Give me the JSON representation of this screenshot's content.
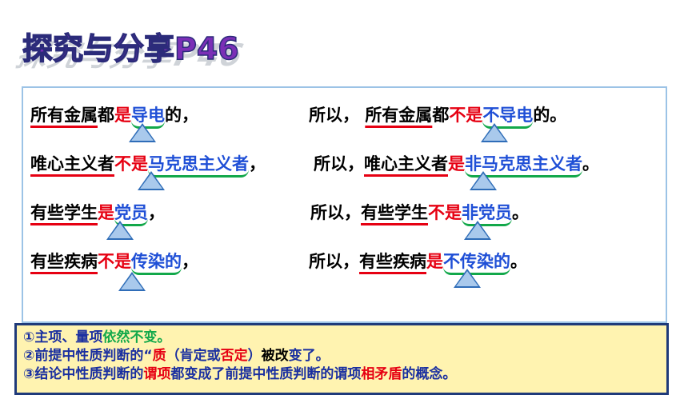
{
  "title": "探究与分享P46",
  "rows": [
    {
      "left": {
        "p1": "所有金属",
        "p2": "都",
        "p3": "是",
        "p4": "导电",
        "p5": "的，"
      },
      "right": {
        "lead": "所以，",
        "p1": "所有金属",
        "p2": "都",
        "p3": "不是",
        "p4": "不导电",
        "p5": "的。"
      }
    },
    {
      "left": {
        "p1": "唯心主义者",
        "p3": "不是",
        "p4": "马克思主义者",
        "p5": "，"
      },
      "right": {
        "lead": "所以，",
        "p1": "唯心主义者",
        "p3": "是",
        "p4": "非马克思主义者",
        "p5": "。"
      }
    },
    {
      "left": {
        "p1": "有些学生",
        "p3": "是",
        "p4": "党员",
        "p5": "，"
      },
      "right": {
        "lead": "所以，",
        "p1": "有些学生",
        "p3": "不是",
        "p4": "非党员",
        "p5": "。"
      }
    },
    {
      "left": {
        "p1": "有些疾病",
        "p3": "不是",
        "p4": "传染的",
        "p5": "，"
      },
      "right": {
        "lead": "所以，",
        "p1": "有些疾病",
        "p3": "是",
        "p4": "不传染的",
        "p5": "。"
      }
    }
  ],
  "notes": {
    "n1": {
      "a": "①主项、量项",
      "b": "依然不变。"
    },
    "n2": {
      "a": "②前提中性质判断的“",
      "b": "质",
      "c": "（肯定或",
      "d": "否定",
      "e": "）",
      "f": "被改",
      "g": "变了。"
    },
    "n3": {
      "a": "③结论中性质判断的",
      "b": "谓项",
      "c": "都变成了前提中性质判断的谓项",
      "d": "相矛盾",
      "e": "的概念。"
    }
  },
  "colors": {
    "red": "#e60012",
    "blue": "#1f4fd6",
    "green": "#12a84a",
    "triangle": "#2f6db8",
    "note_bg": "#fff3b0"
  }
}
